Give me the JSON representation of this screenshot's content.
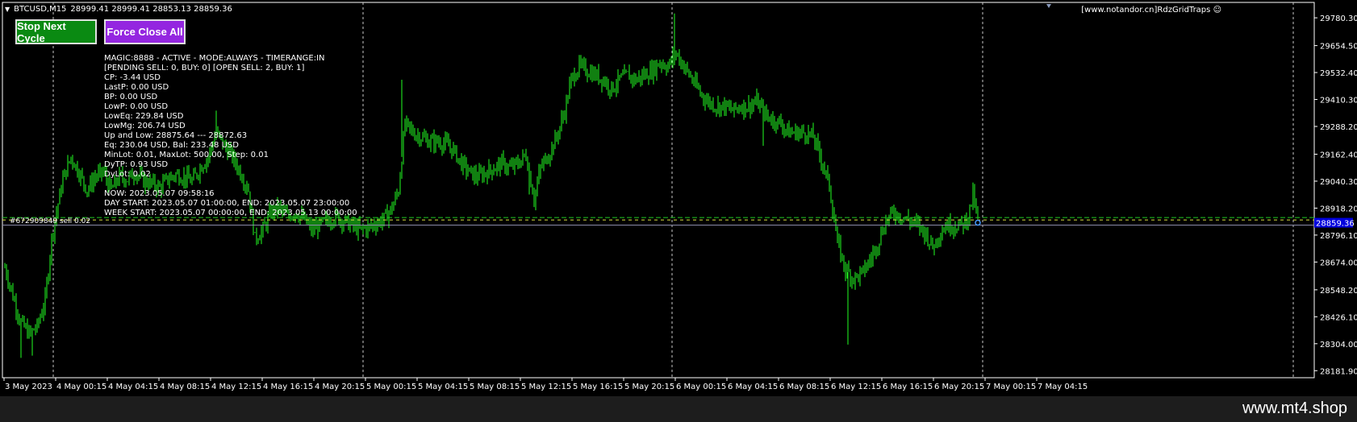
{
  "header": {
    "symbol": "BTCUSD,M15",
    "ohlc": "28999.41 28999.41 28853.13 28859.36",
    "brand": "[www.notandor.cn]RdzGridTraps"
  },
  "buttons": {
    "stop_label": "Stop Next Cycle",
    "force_label": "Force Close All"
  },
  "info_lines": [
    "MAGIC:8888 - ACTIVE - MODE:ALWAYS - TIMERANGE:IN",
    "[PENDING SELL: 0, BUY: 0] [OPEN SELL: 2, BUY: 1]",
    "CP: -3.44 USD",
    "LastP: 0.00 USD",
    "BP: 0.00 USD",
    "LowP: 0.00 USD",
    "LowEq: 229.84 USD",
    "LowMg: 206.74 USD",
    "Up and Low: 28875.64 --- 28872.63",
    "Eq: 230.04 USD, Bal: 233.48 USD",
    "MinLot: 0.01, MaxLot: 500.00, Step: 0.01",
    "DyTP: 0.93 USD",
    "DyLot: 0.02",
    "",
    "NOW: 2023.05.07 09:58:16",
    "DAY START: 2023.05.07 01:00:00, END: 2023.05.07 23:00:00",
    "WEEK START: 2023.05.07 00:00:00, END: 2023.05.13 00:00:00"
  ],
  "order_label": "#672909849 sell 0.02",
  "footer": "www.mt4.shop",
  "chart_data": {
    "type": "bar",
    "title": "BTCUSD,M15",
    "xlabel": "",
    "ylabel": "",
    "ylim": [
      28150,
      29850
    ],
    "grid": true,
    "x_ticks": [
      "3 May 2023",
      "4 May 00:15",
      "4 May 04:15",
      "4 May 08:15",
      "4 May 12:15",
      "4 May 16:15",
      "4 May 20:15",
      "5 May 00:15",
      "5 May 04:15",
      "5 May 08:15",
      "5 May 12:15",
      "5 May 16:15",
      "5 May 20:15",
      "6 May 00:15",
      "6 May 04:15",
      "6 May 08:15",
      "6 May 12:15",
      "6 May 16:15",
      "6 May 20:15",
      "7 May 00:15",
      "7 May 04:15"
    ],
    "y_ticks": [
      "29780.30",
      "29654.50",
      "29532.40",
      "29410.30",
      "29288.20",
      "29162.40",
      "29040.30",
      "28918.20",
      "28796.10",
      "28674.00",
      "28548.20",
      "28426.10",
      "28304.00",
      "28181.90"
    ],
    "current_price": "28859.36",
    "level_price": "28875.64",
    "close_path": [
      [
        0,
        28650
      ],
      [
        10,
        28520
      ],
      [
        20,
        28400
      ],
      [
        30,
        28350
      ],
      [
        40,
        28380
      ],
      [
        50,
        28500
      ],
      [
        58,
        28780
      ],
      [
        64,
        28900
      ],
      [
        72,
        29050
      ],
      [
        82,
        29150
      ],
      [
        92,
        29080
      ],
      [
        102,
        29000
      ],
      [
        112,
        29060
      ],
      [
        122,
        29080
      ],
      [
        132,
        29000
      ],
      [
        142,
        29060
      ],
      [
        152,
        29050
      ],
      [
        162,
        29080
      ],
      [
        172,
        29040
      ],
      [
        182,
        29030
      ],
      [
        192,
        29010
      ],
      [
        202,
        29050
      ],
      [
        212,
        29070
      ],
      [
        222,
        29060
      ],
      [
        232,
        29040
      ],
      [
        242,
        29100
      ],
      [
        252,
        29150
      ],
      [
        262,
        29260
      ],
      [
        272,
        29200
      ],
      [
        282,
        29150
      ],
      [
        292,
        29080
      ],
      [
        302,
        29000
      ],
      [
        310,
        28780
      ],
      [
        320,
        28820
      ],
      [
        330,
        28900
      ],
      [
        340,
        28920
      ],
      [
        350,
        28880
      ],
      [
        360,
        28900
      ],
      [
        370,
        28870
      ],
      [
        380,
        28820
      ],
      [
        390,
        28840
      ],
      [
        400,
        28860
      ],
      [
        410,
        28880
      ],
      [
        420,
        28860
      ],
      [
        430,
        28840
      ],
      [
        440,
        28820
      ],
      [
        450,
        28830
      ],
      [
        460,
        28850
      ],
      [
        470,
        28870
      ],
      [
        480,
        28920
      ],
      [
        488,
        29000
      ],
      [
        496,
        29300
      ],
      [
        506,
        29260
      ],
      [
        516,
        29240
      ],
      [
        526,
        29220
      ],
      [
        536,
        29220
      ],
      [
        546,
        29210
      ],
      [
        556,
        29180
      ],
      [
        566,
        29120
      ],
      [
        576,
        29080
      ],
      [
        586,
        29060
      ],
      [
        596,
        29080
      ],
      [
        606,
        29100
      ],
      [
        616,
        29120
      ],
      [
        626,
        29100
      ],
      [
        636,
        29120
      ],
      [
        646,
        29160
      ],
      [
        656,
        28960
      ],
      [
        664,
        29100
      ],
      [
        674,
        29160
      ],
      [
        684,
        29240
      ],
      [
        694,
        29360
      ],
      [
        702,
        29500
      ],
      [
        712,
        29560
      ],
      [
        722,
        29540
      ],
      [
        732,
        29520
      ],
      [
        742,
        29500
      ],
      [
        752,
        29460
      ],
      [
        762,
        29500
      ],
      [
        772,
        29520
      ],
      [
        782,
        29500
      ],
      [
        792,
        29520
      ],
      [
        802,
        29540
      ],
      [
        812,
        29580
      ],
      [
        822,
        29560
      ],
      [
        832,
        29620
      ],
      [
        842,
        29560
      ],
      [
        852,
        29500
      ],
      [
        862,
        29440
      ],
      [
        872,
        29400
      ],
      [
        882,
        29380
      ],
      [
        892,
        29380
      ],
      [
        902,
        29360
      ],
      [
        912,
        29380
      ],
      [
        922,
        29380
      ],
      [
        932,
        29400
      ],
      [
        942,
        29340
      ],
      [
        952,
        29320
      ],
      [
        962,
        29300
      ],
      [
        972,
        29260
      ],
      [
        982,
        29260
      ],
      [
        992,
        29260
      ],
      [
        1002,
        29240
      ],
      [
        1012,
        29140
      ],
      [
        1022,
        29020
      ],
      [
        1032,
        28760
      ],
      [
        1042,
        28640
      ],
      [
        1052,
        28600
      ],
      [
        1062,
        28620
      ],
      [
        1072,
        28680
      ],
      [
        1082,
        28760
      ],
      [
        1092,
        28860
      ],
      [
        1102,
        28900
      ],
      [
        1112,
        28880
      ],
      [
        1122,
        28860
      ],
      [
        1132,
        28840
      ],
      [
        1142,
        28800
      ],
      [
        1150,
        28740
      ],
      [
        1158,
        28800
      ],
      [
        1166,
        28840
      ],
      [
        1176,
        28840
      ],
      [
        1186,
        28840
      ],
      [
        1194,
        28880
      ],
      [
        1200,
        28980
      ],
      [
        1206,
        28860
      ]
    ]
  }
}
